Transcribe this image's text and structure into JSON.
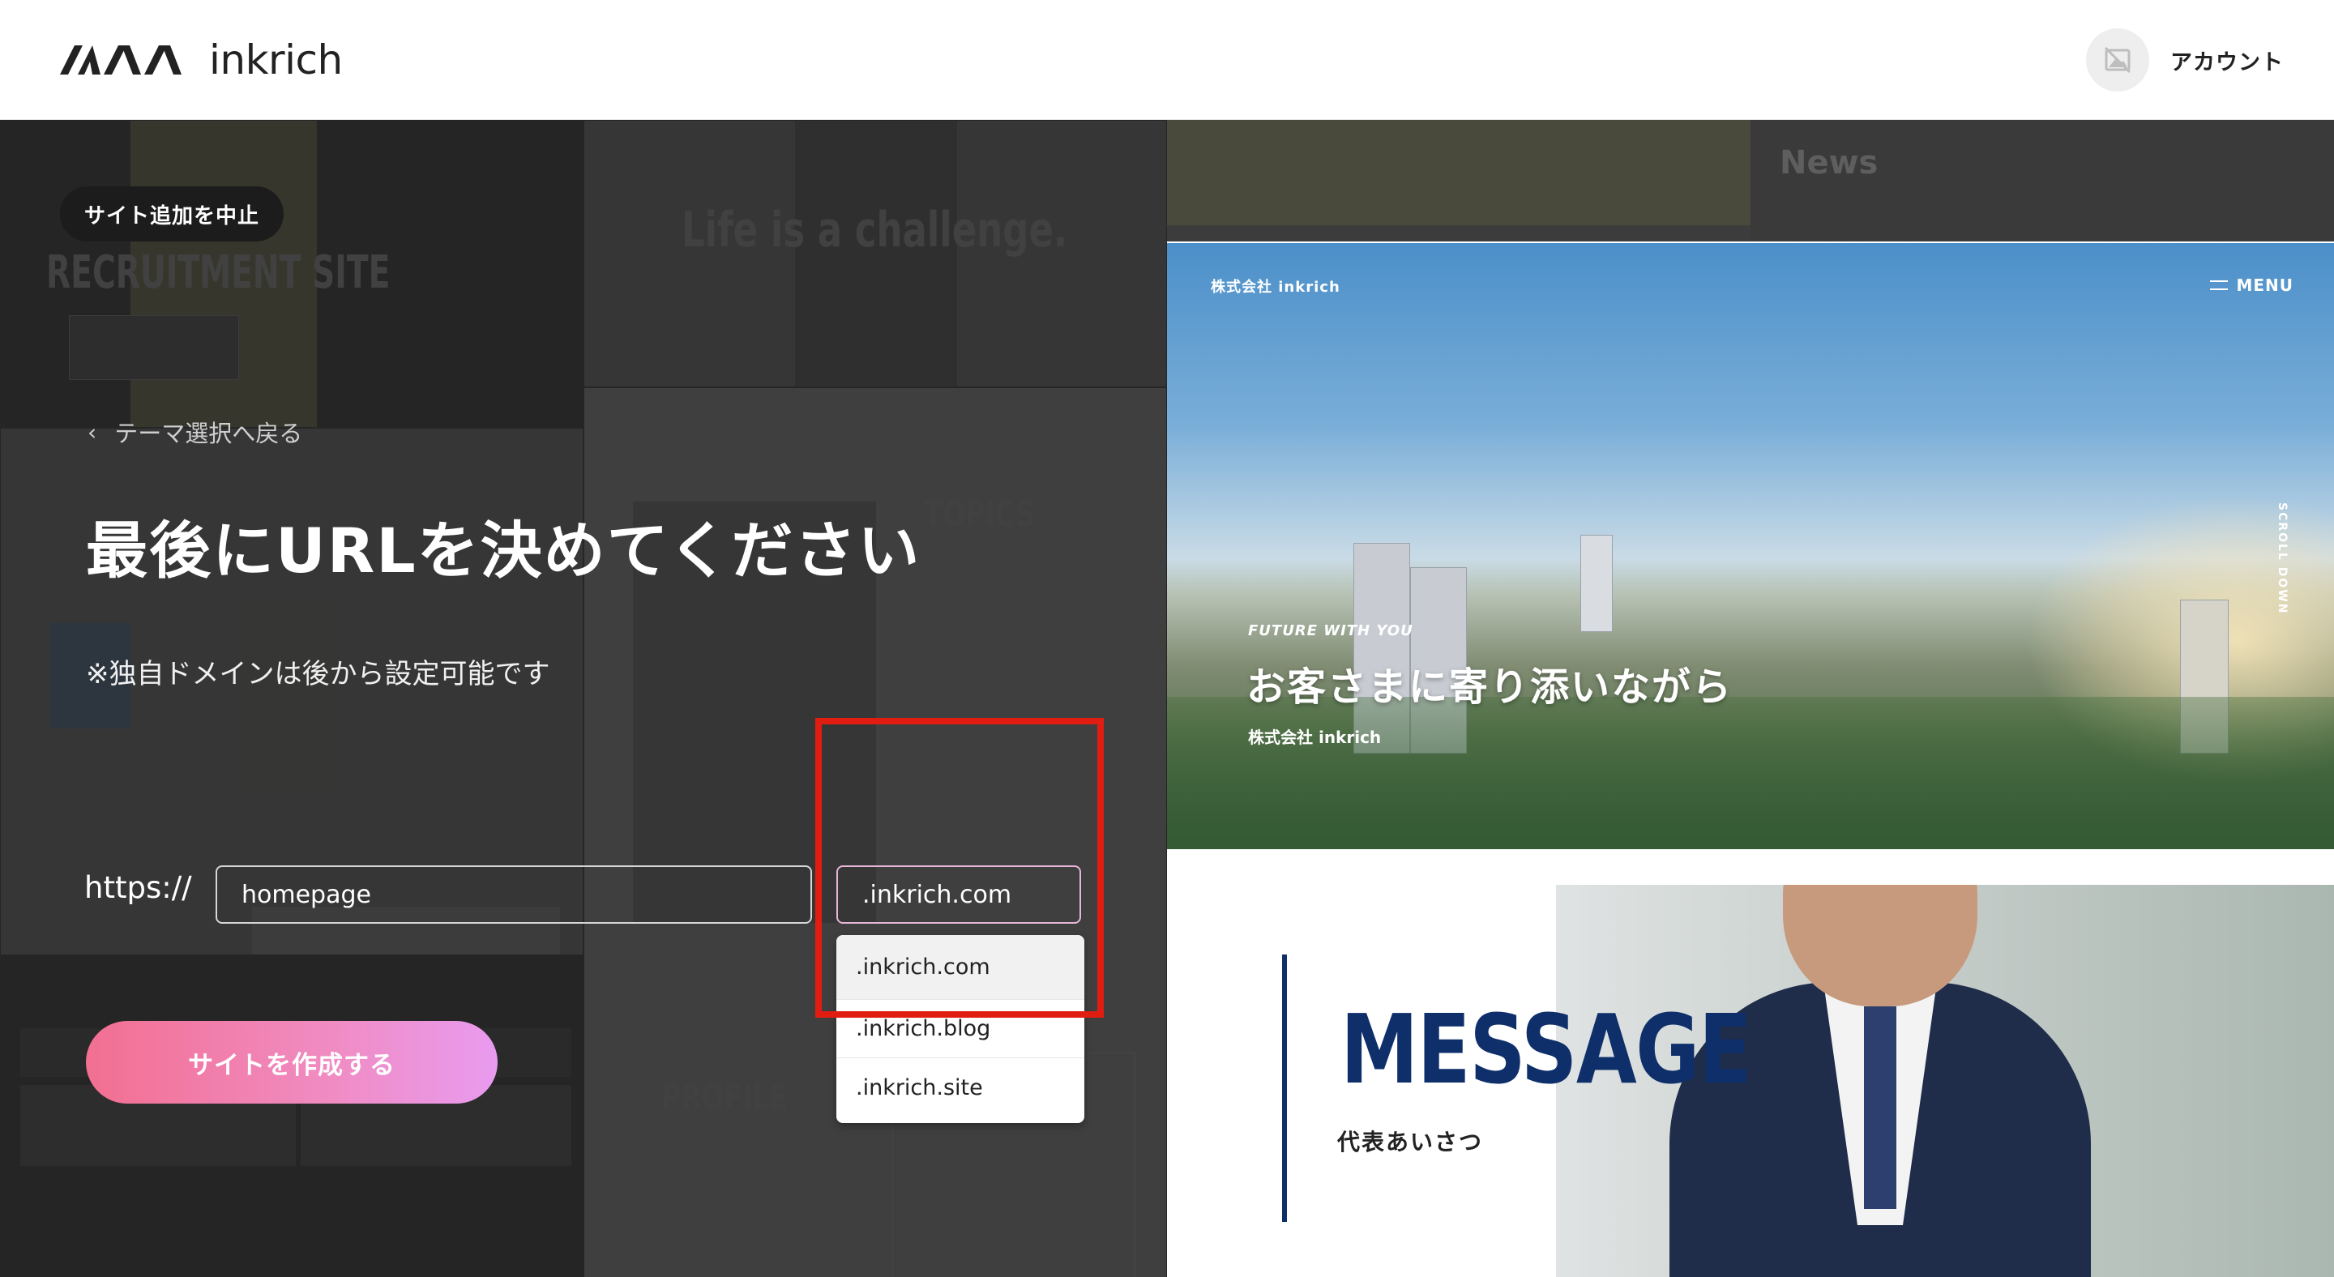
{
  "header": {
    "logo_text": "inkrich",
    "account_label": "アカウント",
    "icons": {
      "logo": "inkrich-logo-mark",
      "avatar": "no-image-avatar-icon"
    }
  },
  "form": {
    "cancel_label": "サイト追加を中止",
    "back_label": "テーマ選択へ戻る",
    "title": "最後にURLを決めてください",
    "note": "※独自ドメインは後から設定可能です",
    "scheme": "https://",
    "subdomain_value": "homepage",
    "domain_selected": ".inkrich.com",
    "domain_options": [
      ".inkrich.com",
      ".inkrich.blog",
      ".inkrich.site"
    ],
    "submit_label": "サイトを作成する"
  },
  "background_theme_samples": {
    "recruitment": "RECRUITMENT SITE",
    "life": "Life is a challenge.",
    "topics": "TOPICS",
    "profile": "PROFILE"
  },
  "preview": {
    "news": "News",
    "company": "株式会社 inkrich",
    "menu_label": "MENU",
    "scroll_label": "SCROLL DOWN",
    "tagline": "FUTURE WITH YOU",
    "headline": "お客さまに寄り添いながら",
    "sub": "株式会社 inkrich",
    "message_title": "MESSAGE",
    "message_sub": "代表あいさつ"
  },
  "colors": {
    "highlight": "#e11d12",
    "button_gradient_start": "#f26f91",
    "button_gradient_end": "#e99bf0",
    "message_navy": "#0f2f6b"
  }
}
